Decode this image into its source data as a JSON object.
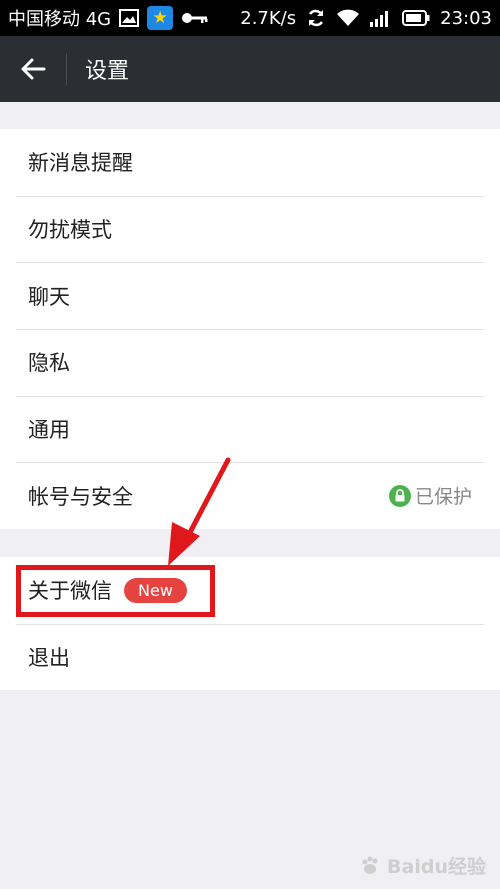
{
  "status_bar": {
    "carrier": "中国移动 4G",
    "speed": "2.7K/s",
    "time": "23:03"
  },
  "header": {
    "title": "设置"
  },
  "settings": {
    "group1": [
      {
        "label": "新消息提醒"
      },
      {
        "label": "勿扰模式"
      },
      {
        "label": "聊天"
      },
      {
        "label": "隐私"
      },
      {
        "label": "通用"
      },
      {
        "label": "帐号与安全",
        "value": "已保护"
      }
    ],
    "group2": [
      {
        "label": "关于微信",
        "badge": "New"
      },
      {
        "label": "退出"
      }
    ]
  },
  "watermark": "Baidu经验",
  "colors": {
    "title_bar": "#2b2f33",
    "badge": "#e64340",
    "highlight": "#e0181c",
    "protect_green": "#4cb34c"
  }
}
